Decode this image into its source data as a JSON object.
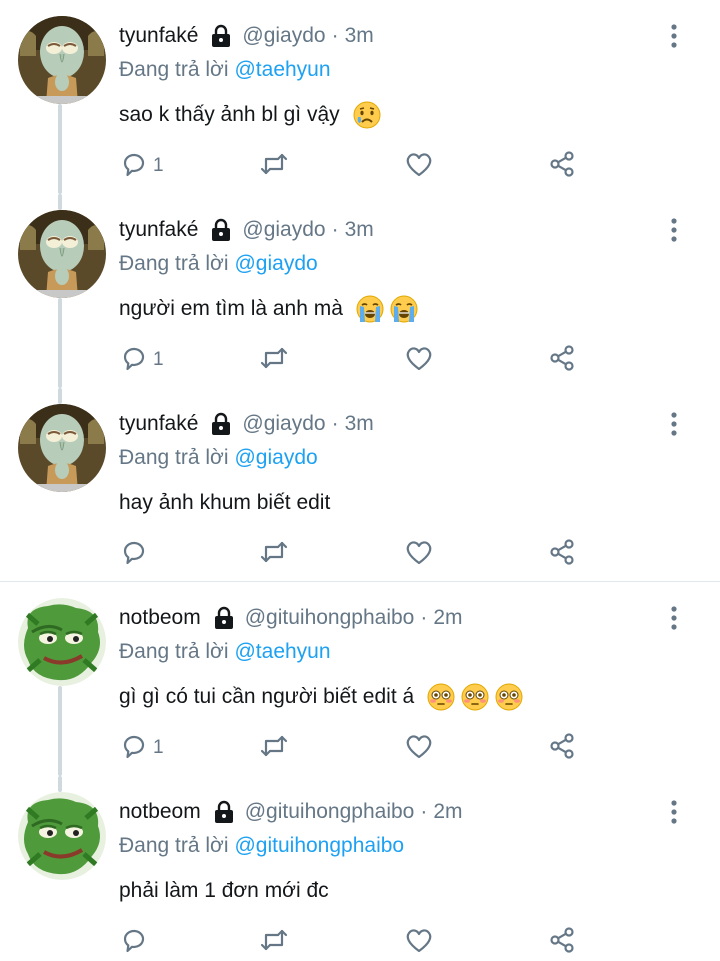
{
  "colors": {
    "accent": "#1da1f2",
    "muted": "#657786",
    "text": "#14171a",
    "thread": "#cfd9de"
  },
  "tweets": [
    {
      "name": "tyunfaké",
      "handle": "@giaydo",
      "time": "3m",
      "replying_label": "Đang trả lời",
      "mention": "@taehyun",
      "text": "sao k thấy ảnh bl gì vậy",
      "emoji": [
        "crying-face"
      ],
      "reply_count": "1",
      "avatar": "squidward-avatar"
    },
    {
      "name": "tyunfaké",
      "handle": "@giaydo",
      "time": "3m",
      "replying_label": "Đang trả lời",
      "mention": "@giaydo",
      "text": "người em tìm là anh mà",
      "emoji": [
        "loudly-crying-face",
        "loudly-crying-face"
      ],
      "reply_count": "1",
      "avatar": "squidward-avatar"
    },
    {
      "name": "tyunfaké",
      "handle": "@giaydo",
      "time": "3m",
      "replying_label": "Đang trả lời",
      "mention": "@giaydo",
      "text": "hay ảnh khum biết edit",
      "emoji": [],
      "reply_count": "",
      "avatar": "squidward-avatar"
    },
    {
      "name": "notbeom",
      "handle": "@gituihongphaibo",
      "time": "2m",
      "replying_label": "Đang trả lời",
      "mention": "@taehyun",
      "text": "gì gì có tui cần người biết edit á",
      "emoji": [
        "flushed-face",
        "flushed-face",
        "flushed-face"
      ],
      "reply_count": "1",
      "avatar": "pepe-avatar"
    },
    {
      "name": "notbeom",
      "handle": "@gituihongphaibo",
      "time": "2m",
      "replying_label": "Đang trả lời",
      "mention": "@gituihongphaibo",
      "text": "phải làm 1 đơn mới đc",
      "emoji": [],
      "reply_count": "",
      "avatar": "pepe-avatar"
    }
  ]
}
